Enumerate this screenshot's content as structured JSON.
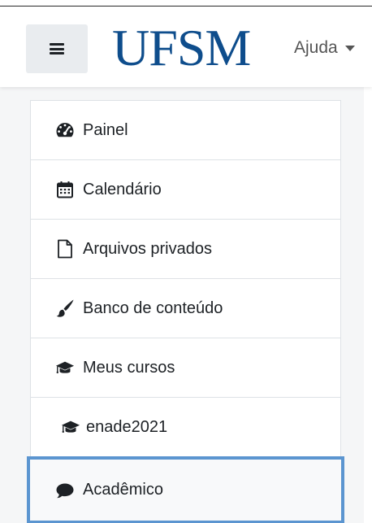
{
  "navbar": {
    "brand": "UFSM",
    "help_label": "Ajuda",
    "icons": {
      "menu": "hamburger-icon",
      "help_caret": "caret-down-icon"
    }
  },
  "nav": {
    "items": [
      {
        "label": "Painel",
        "icon": "dashboard-icon"
      },
      {
        "label": "Calendário",
        "icon": "calendar-icon"
      },
      {
        "label": "Arquivos privados",
        "icon": "file-icon"
      },
      {
        "label": "Banco de conteúdo",
        "icon": "paintbrush-icon"
      },
      {
        "label": "Meus cursos",
        "icon": "graduation-cap-icon"
      },
      {
        "label": "enade2021",
        "icon": "graduation-cap-icon"
      },
      {
        "label": "Acadêmico",
        "icon": "comment-icon",
        "active": true
      }
    ]
  },
  "colors": {
    "brand": "#0e4d8c",
    "active_outline": "#5b95d0",
    "toggle_background": "#e9ecef"
  }
}
